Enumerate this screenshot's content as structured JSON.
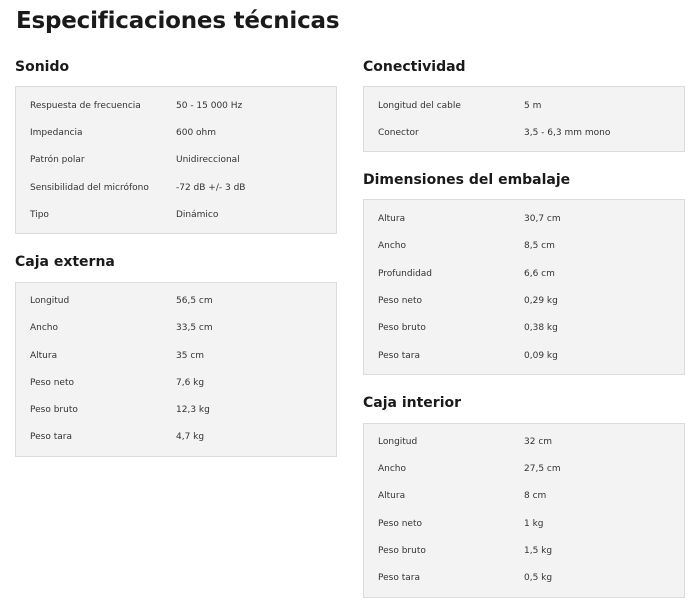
{
  "page": {
    "title": "Especificaciones técnicas"
  },
  "sections": [
    {
      "id": "sonido",
      "title": "Sonido",
      "rows": [
        {
          "label": "Respuesta de frecuencia",
          "value": "50 - 15 000  Hz"
        },
        {
          "label": "Impedancia",
          "value": "600 ohm"
        },
        {
          "label": "Patrón polar",
          "value": "Unidireccional"
        },
        {
          "label": "Sensibilidad del micrófono",
          "value": "-72 dB +/- 3 dB"
        },
        {
          "label": "Tipo",
          "value": "Dinámico"
        }
      ]
    },
    {
      "id": "caja-externa",
      "title": "Caja externa",
      "rows": [
        {
          "label": "Longitud",
          "value": "56,5  cm"
        },
        {
          "label": "Ancho",
          "value": "33,5  cm"
        },
        {
          "label": "Altura",
          "value": "35  cm"
        },
        {
          "label": "Peso neto",
          "value": "7,6  kg"
        },
        {
          "label": "Peso bruto",
          "value": "12,3  kg"
        },
        {
          "label": "Peso tara",
          "value": "4,7  kg"
        }
      ]
    },
    {
      "id": "conectividad",
      "title": "Conectividad",
      "rows": [
        {
          "label": "Longitud del cable",
          "value": "5 m"
        },
        {
          "label": "Conector",
          "value": "3,5 - 6,3 mm mono"
        }
      ]
    },
    {
      "id": "dimensiones-del-embalaje",
      "title": "Dimensiones del embalaje",
      "rows": [
        {
          "label": "Altura",
          "value": "30,7  cm"
        },
        {
          "label": "Ancho",
          "value": "8,5  cm"
        },
        {
          "label": "Profundidad",
          "value": "6,6  cm"
        },
        {
          "label": "Peso neto",
          "value": "0,29  kg"
        },
        {
          "label": "Peso bruto",
          "value": "0,38  kg"
        },
        {
          "label": "Peso tara",
          "value": "0,09  kg"
        }
      ]
    },
    {
      "id": "caja-interior",
      "title": "Caja interior",
      "rows": [
        {
          "label": "Longitud",
          "value": "32  cm"
        },
        {
          "label": "Ancho",
          "value": "27,5  cm"
        },
        {
          "label": "Altura",
          "value": "8  cm"
        },
        {
          "label": "Peso neto",
          "value": "1  kg"
        },
        {
          "label": "Peso bruto",
          "value": "1,5  kg"
        },
        {
          "label": "Peso tara",
          "value": "0,5  kg"
        }
      ]
    }
  ]
}
